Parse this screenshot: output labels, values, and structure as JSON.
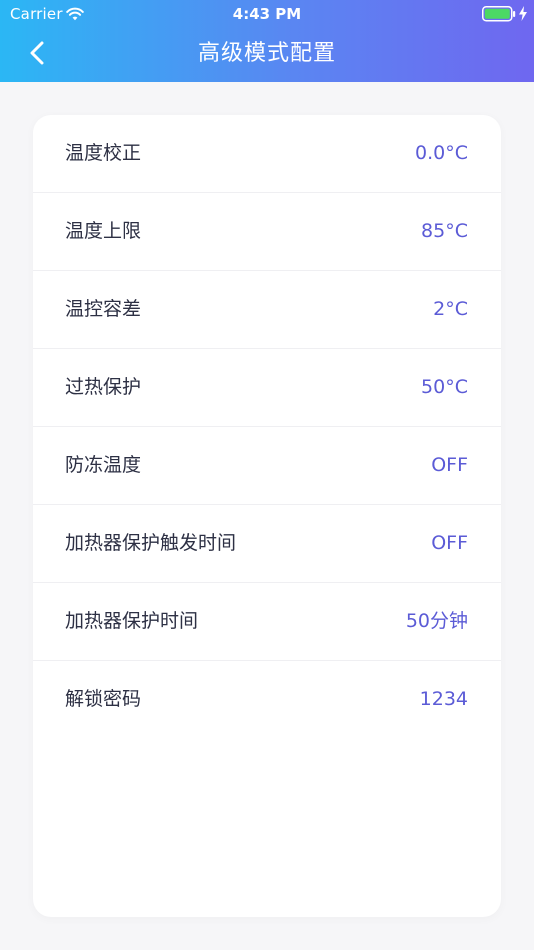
{
  "status_bar": {
    "carrier": "Carrier",
    "time": "4:43 PM",
    "wifi_icon": "wifi-icon",
    "battery_icon": "battery-icon",
    "charging_icon": "charging-bolt-icon"
  },
  "nav": {
    "title": "高级模式配置",
    "back_icon": "chevron-left-icon"
  },
  "colors": {
    "header_gradient_start": "#2bb7f4",
    "header_gradient_end": "#6f67f0",
    "value_color": "#5b5bd6",
    "label_color": "#2d3044",
    "battery_fill": "#4cd964"
  },
  "settings": [
    {
      "label": "温度校正",
      "value": "0.0°C"
    },
    {
      "label": "温度上限",
      "value": "85°C"
    },
    {
      "label": "温控容差",
      "value": "2°C"
    },
    {
      "label": "过热保护",
      "value": "50°C"
    },
    {
      "label": "防冻温度",
      "value": "OFF"
    },
    {
      "label": "加热器保护触发时间",
      "value": "OFF"
    },
    {
      "label": "加热器保护时间",
      "value": "50分钟"
    },
    {
      "label": "解锁密码",
      "value": "1234"
    }
  ]
}
